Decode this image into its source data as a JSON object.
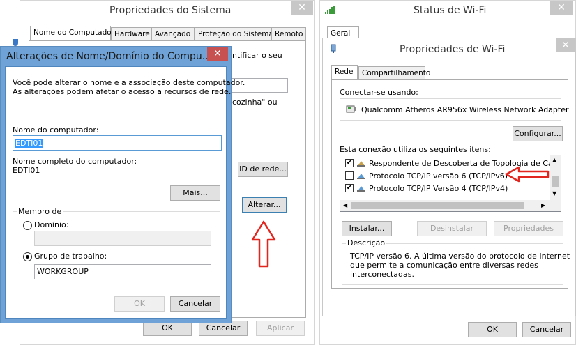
{
  "system_props": {
    "title": "Propriedades do Sistema",
    "tabs": [
      "Nome do Computador",
      "Hardware",
      "Avançado",
      "Proteção do Sistema",
      "Remoto"
    ],
    "partial_text_1": "ntificar o seu",
    "partial_text_2": "cozinha\" ou",
    "network_id_button": "ID de rede...",
    "change_button": "Alterar...",
    "ok_button": "OK",
    "cancel_button": "Cancelar",
    "apply_button": "Aplicar"
  },
  "rename_dialog": {
    "title": "Alterações de Nome/Domínio do Compu...",
    "description_line1": "Você pode alterar o nome e a associação deste computador.",
    "description_line2": "As alterações podem afetar o acesso a recursos de rede.",
    "computer_name_label": "Nome do computador:",
    "computer_name_value": "EDTI01",
    "full_name_label": "Nome completo do computador:",
    "full_name_value": "EDTI01",
    "more_button": "Mais...",
    "member_of_label": "Membro de",
    "domain_label": "Domínio:",
    "domain_value": "",
    "workgroup_label": "Grupo de trabalho:",
    "workgroup_value": "WORKGROUP",
    "selected_membership": "workgroup",
    "ok_button": "OK",
    "cancel_button": "Cancelar"
  },
  "wifi_status": {
    "title": "Status de Wi-Fi",
    "tab": "Geral",
    "ok_button": "OK",
    "cancel_button": "Cancelar"
  },
  "wifi_props": {
    "title": "Propriedades de Wi-Fi",
    "tabs": [
      "Rede",
      "Compartilhamento"
    ],
    "connect_using_label": "Conectar-se usando:",
    "adapter_name": "Qualcomm Atheros AR956x Wireless Network Adapter",
    "configure_button": "Configurar...",
    "items_label": "Esta conexão utiliza os seguintes itens:",
    "items": [
      {
        "label": "Respondente de Descoberta de Topologia de Camada",
        "checked": true
      },
      {
        "label": "Protocolo TCP/IP versão 6 (TCP/IPv6)",
        "checked": false
      },
      {
        "label": "Protocolo TCP/IP Versão 4 (TCP/IPv4)",
        "checked": true
      }
    ],
    "install_button": "Instalar...",
    "uninstall_button": "Desinstalar",
    "properties_button": "Propriedades",
    "description_label": "Descrição",
    "description_line1": "TCP/IP versão 6. A última versão do protocolo de Internet",
    "description_line2": "que permite a comunicação entre diversas redes",
    "description_line3": "interconectadas."
  },
  "colors": {
    "annotation_red": "#e0261e",
    "dialog_frame": "#6fa3d8"
  }
}
